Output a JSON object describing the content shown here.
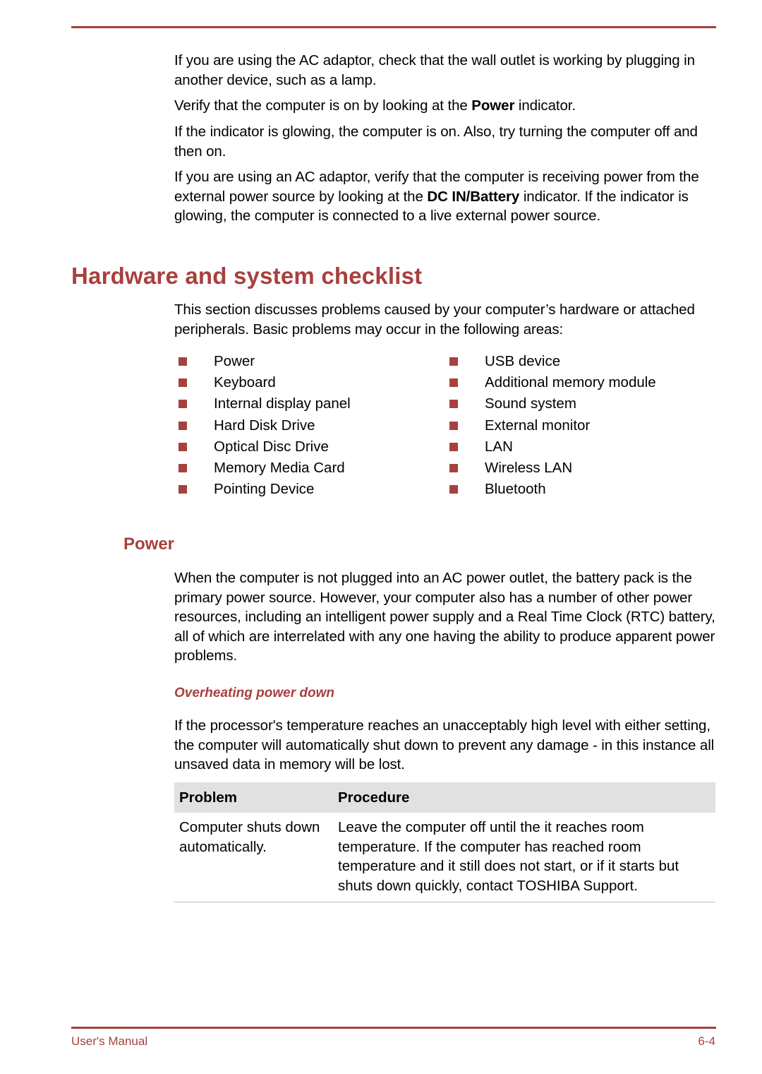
{
  "intro_paragraphs": {
    "p1": "If you are using the AC adaptor, check that the wall outlet is working by plugging in another device, such as a lamp.",
    "p2_before": "Verify that the computer is on by looking at the ",
    "p2_bold": "Power",
    "p2_after": " indicator.",
    "p3": "If the indicator is glowing, the computer is on. Also, try turning the computer off and then on.",
    "p4_before": "If you are using an AC adaptor, verify that the computer is receiving power from the external power source by looking at the ",
    "p4_bold": "DC IN/Battery",
    "p4_after": " indicator. If the indicator is glowing, the computer is connected to a live external power source."
  },
  "section": {
    "title": "Hardware and system checklist",
    "intro": "This section discusses problems caused by your computer’s hardware or attached peripherals. Basic problems may occur in the following areas:",
    "checklist_col1": [
      "Power",
      "Keyboard",
      "Internal display panel",
      "Hard Disk Drive",
      "Optical Disc Drive",
      "Memory Media Card",
      "Pointing Device"
    ],
    "checklist_col2": [
      "USB device",
      "Additional memory module",
      "Sound system",
      "External monitor",
      "LAN",
      "Wireless LAN",
      "Bluetooth"
    ]
  },
  "power": {
    "title": "Power",
    "body": "When the computer is not plugged into an AC power outlet, the battery pack is the primary power source. However, your computer also has a number of other power resources, including an intelligent power supply and a Real Time Clock (RTC) battery, all of which are interrelated with any one having the ability to produce apparent power problems.",
    "overheating": {
      "title": "Overheating power down",
      "body": "If the processor's temperature reaches an unacceptably high level with either setting, the computer will automatically shut down to prevent any damage - in this instance all unsaved data in memory will be lost.",
      "table": {
        "headers": [
          "Problem",
          "Procedure"
        ],
        "rows": [
          [
            "Computer shuts down automatically.",
            "Leave the computer off until the it reaches room temperature. If the computer has reached room temperature and it still does not start, or if it starts but shuts down quickly, contact TOSHIBA Support."
          ]
        ]
      }
    }
  },
  "footer": {
    "left": "User's Manual",
    "right": "6-4"
  },
  "colors": {
    "accent": "#a8403e",
    "table_header_bg": "#e1e1e1"
  }
}
